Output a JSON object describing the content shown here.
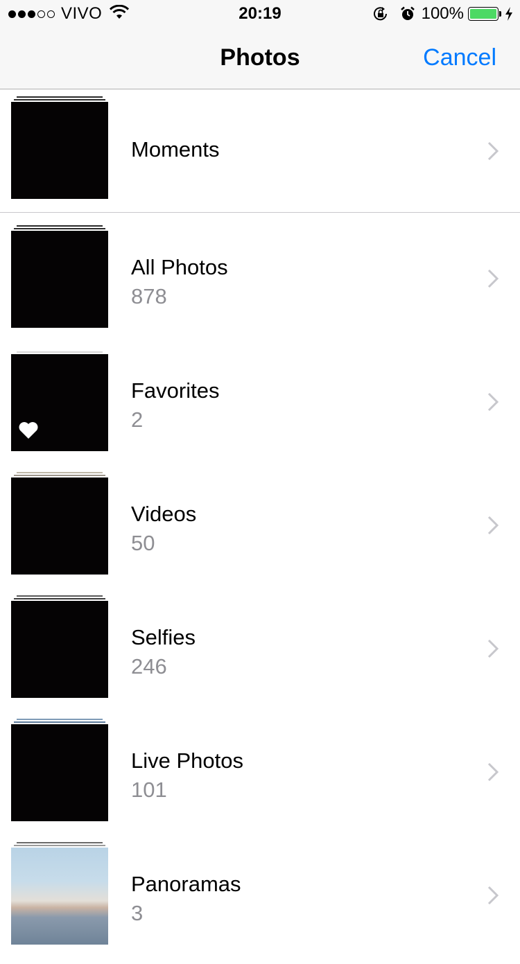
{
  "status_bar": {
    "signal_dots": [
      true,
      true,
      true,
      false,
      false
    ],
    "carrier": "VIVO",
    "time": "20:19",
    "battery_percent": "100%",
    "battery_level": 1.0,
    "battery_color": "#4cd964",
    "icons": [
      "wifi-icon",
      "rotation-lock-icon",
      "alarm-icon",
      "charging-bolt-icon"
    ]
  },
  "nav": {
    "title": "Photos",
    "cancel_label": "Cancel",
    "accent_color": "#007aff"
  },
  "albums": [
    {
      "name": "Moments",
      "count": ""
    },
    {
      "name": "All Photos",
      "count": "878"
    },
    {
      "name": "Favorites",
      "count": "2",
      "badge_icon": "heart-icon"
    },
    {
      "name": "Videos",
      "count": "50"
    },
    {
      "name": "Selfies",
      "count": "246"
    },
    {
      "name": "Live Photos",
      "count": "101"
    },
    {
      "name": "Panoramas",
      "count": "3"
    }
  ]
}
